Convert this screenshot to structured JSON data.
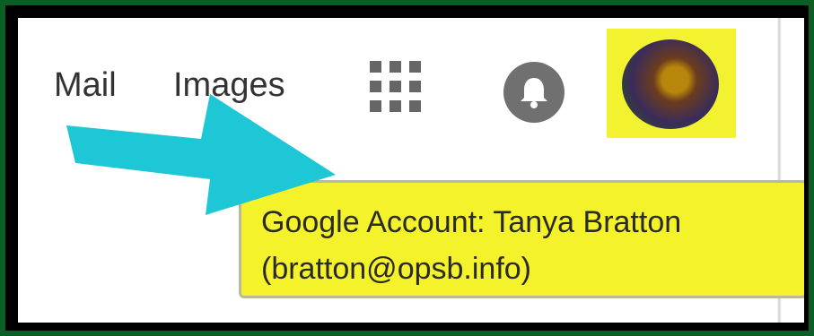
{
  "header": {
    "links": [
      {
        "label": "Mail"
      },
      {
        "label": "Images"
      }
    ],
    "icons": {
      "apps": "apps-grid-icon",
      "notifications": "bell-icon",
      "account": "avatar"
    }
  },
  "tooltip": {
    "line1": "Google Account: Tanya Bratton",
    "line2": "(bratton@opsb.info)"
  },
  "colors": {
    "frame": "#0b5e24",
    "highlight": "#f4f22a",
    "arrow": "#1ec7d6"
  }
}
